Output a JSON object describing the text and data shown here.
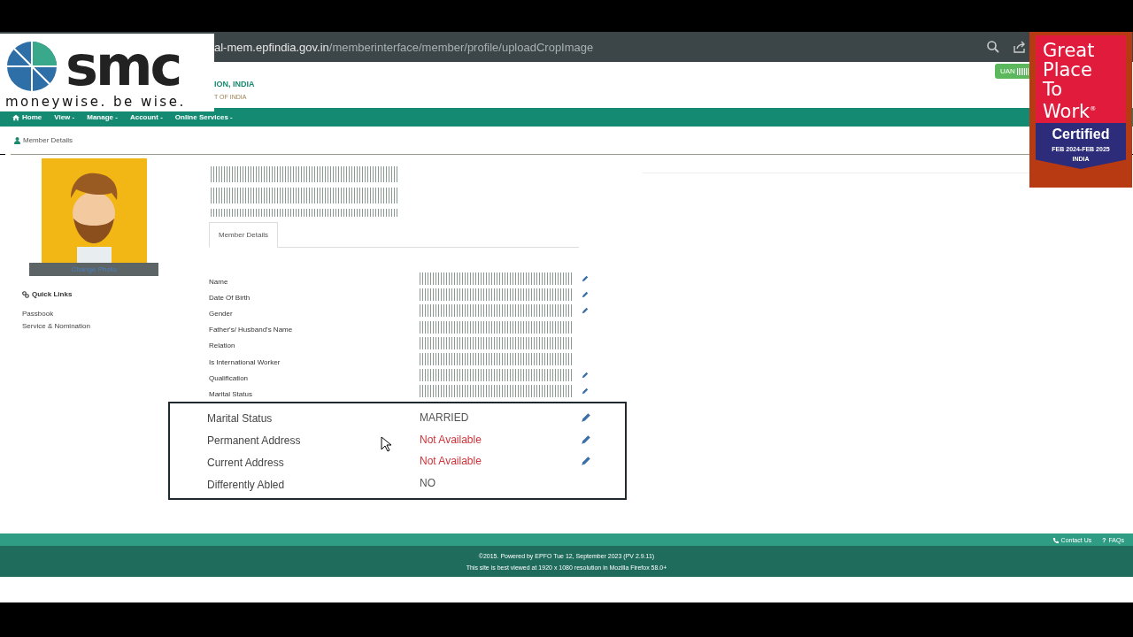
{
  "browser": {
    "url_host": "al-mem.epfindia.gov.in",
    "url_path": "/memberinterface/member/profile/uploadCropImage"
  },
  "header": {
    "org_line": "ION, INDIA",
    "sub_line": "T OF INDIA",
    "uan_label": "UAN"
  },
  "nav": [
    {
      "label": "Home"
    },
    {
      "label": "View",
      "caret": "-"
    },
    {
      "label": "Manage",
      "caret": "-"
    },
    {
      "label": "Account",
      "caret": "-"
    },
    {
      "label": "Online Services",
      "caret": "-"
    }
  ],
  "breadcrumb": "Member Details",
  "photo": {
    "change_label": "Change Photo"
  },
  "quick_links": {
    "title": "Quick Links",
    "items": [
      "Passbook",
      "Service & Nomination"
    ]
  },
  "tabs": [
    {
      "label": "Member Details",
      "selected": true
    }
  ],
  "details": [
    {
      "label": "Name",
      "editable": true
    },
    {
      "label": "Date Of Birth",
      "editable": true
    },
    {
      "label": "Gender",
      "editable": true
    },
    {
      "label": "Father's/ Husband's Name",
      "editable": false
    },
    {
      "label": "Relation",
      "editable": false
    },
    {
      "label": "Is International Worker",
      "editable": false
    },
    {
      "label": "Qualification",
      "editable": true
    },
    {
      "label": "Marital Status",
      "editable": true
    }
  ],
  "highlight": [
    {
      "label": "Marital Status",
      "value": "MARRIED",
      "missing": false,
      "editable": true
    },
    {
      "label": "Permanent Address",
      "value": "Not Available",
      "missing": true,
      "editable": true
    },
    {
      "label": "Current Address",
      "value": "Not Available",
      "missing": true,
      "editable": true
    },
    {
      "label": "Differently Abled",
      "value": "NO",
      "missing": false,
      "editable": false
    }
  ],
  "footer": {
    "links": [
      {
        "label": "Contact Us"
      },
      {
        "label": "FAQs",
        "glyph": "?"
      }
    ],
    "copyright": "©2015. Powered by EPFO Tue 12, September 2023 (PV 2.9.11)",
    "note": "This site is best viewed at 1920 x 1080 resolution in Mozilla Firefox 58.0+"
  },
  "overlays": {
    "smc_logo": "smc",
    "smc_tagline": "moneywise. be wise.",
    "badge_lines": [
      "Great",
      "Place",
      "To",
      "Work"
    ],
    "badge_mark": "®",
    "badge_certified": "Certified",
    "badge_dates": "FEB 2024-FEB 2025",
    "badge_country": "INDIA"
  }
}
